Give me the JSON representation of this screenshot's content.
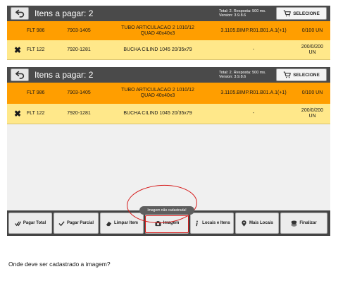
{
  "header": {
    "title": "Itens a pagar: 2",
    "meta_line1": "Total: 2. Resposta: 500 ms.",
    "meta_line2": "Version: 3.9.8.6",
    "select_label": "SELECIONE"
  },
  "rows": [
    {
      "mark": "",
      "flt": "FLT 986",
      "code": "7903-1405",
      "desc_line1": "TUBO ARTICULACAO 2 1010/12",
      "desc_line2": "QUAD 40x40x3",
      "ref": "3.1105.BIMP.R01.B01.A.1(+1)",
      "qty_line1": "0/100 UN",
      "qty_line2": ""
    },
    {
      "mark": "✖",
      "flt": "FLT 122",
      "code": "7920-1281",
      "desc_line1": "BUCHA CILIND 1045 20/35x79",
      "desc_line2": "",
      "ref": "-",
      "qty_line1": "200/0/200",
      "qty_line2": "UN"
    }
  ],
  "toolbar": {
    "pagar_total": "Pagar Total",
    "pagar_parcial": "Pagar Parcial",
    "limpar_item": "Limpar Item",
    "imagem": "Imagem",
    "locais_itens": "Locais e Itens",
    "mais_locais": "Mais Locais",
    "finalizar": "Finalizar"
  },
  "toast": "Imagem não cadastrada!",
  "question": "Onde deve ser cadastrado a imagem?",
  "colors": {
    "header": "#4a4a4a",
    "orange_row": "#ff9e00",
    "yellow_row": "#ffe88a",
    "annotation": "#d61c1c"
  },
  "icons": [
    "back-arrow-icon",
    "cart-icon",
    "check-icon",
    "eraser-icon",
    "camera-icon",
    "info-icon",
    "location-pin-icon",
    "database-icon"
  ]
}
